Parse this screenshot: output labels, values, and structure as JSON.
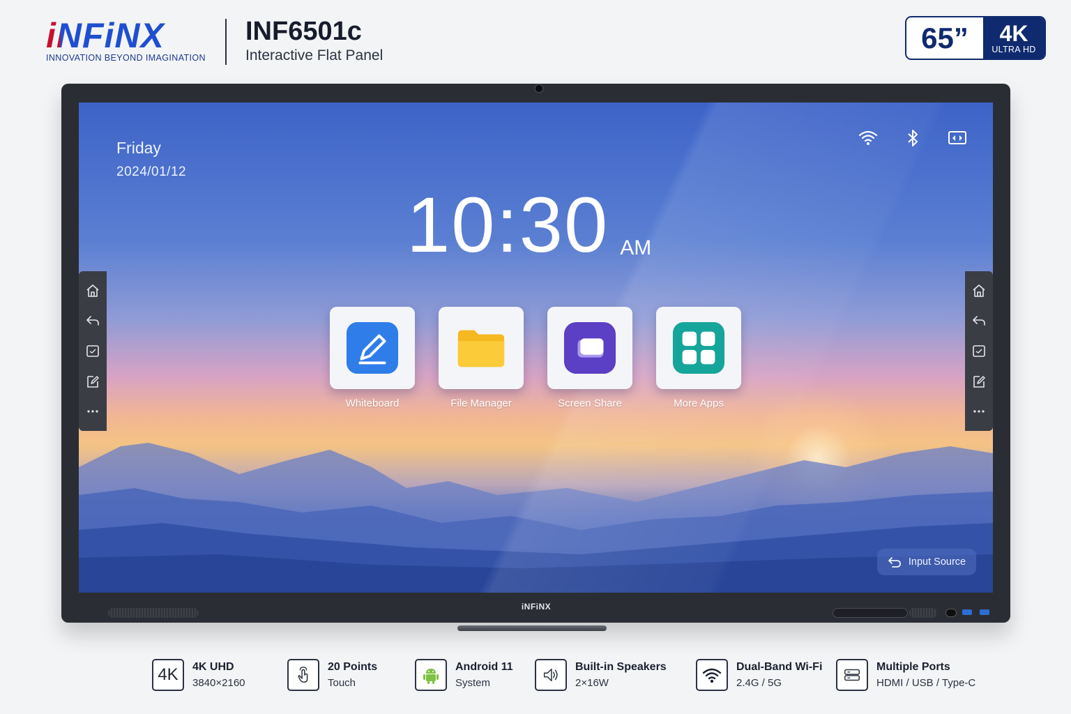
{
  "header": {
    "brand_name": "iNFiNX",
    "brand_tagline": "INNOVATION BEYOND IMAGINATION",
    "model_name": "INF6501c",
    "model_subtitle": "Interactive Flat Panel",
    "size_label": "65”",
    "resolution_label": "4K",
    "resolution_sub": "ULTRA HD"
  },
  "screen": {
    "day": "Friday",
    "date": "2024/01/12",
    "time": "10:30",
    "ampm": "AM",
    "status_icons": [
      "wifi-icon",
      "bluetooth-icon",
      "screen-cast-icon"
    ],
    "apps": [
      {
        "label": "Whiteboard",
        "icon": "whiteboard-icon",
        "color": "#2f7de8"
      },
      {
        "label": "File Manager",
        "icon": "folder-icon",
        "color": "#f6b81f"
      },
      {
        "label": "Screen Share",
        "icon": "screen-share-icon",
        "color": "#5b3fc4"
      },
      {
        "label": "More Apps",
        "icon": "apps-grid-icon",
        "color": "#16a59a"
      }
    ],
    "input_source_label": "Input Source",
    "sidebar_icons": [
      "home-icon",
      "back-icon",
      "screenshot-icon",
      "annotate-icon",
      "more-icon"
    ]
  },
  "bezel_logo": "iNFiNX",
  "features": [
    {
      "title": "4K UHD",
      "sub": "3840×2160",
      "icon": "4k-icon",
      "icon_text": "4K"
    },
    {
      "title": "20 Points",
      "sub": "Touch",
      "icon": "touch-icon"
    },
    {
      "title": "Android 11",
      "sub": "System",
      "icon": "android-icon"
    },
    {
      "title": "Built-in Speakers",
      "sub": "2×16W",
      "icon": "speaker-icon"
    },
    {
      "title": "Dual-Band Wi-Fi",
      "sub": "2.4G / 5G",
      "icon": "wifi-icon"
    },
    {
      "title": "Multiple Ports",
      "sub": "HDMI / USB / Type-C",
      "icon": "ports-icon"
    }
  ]
}
